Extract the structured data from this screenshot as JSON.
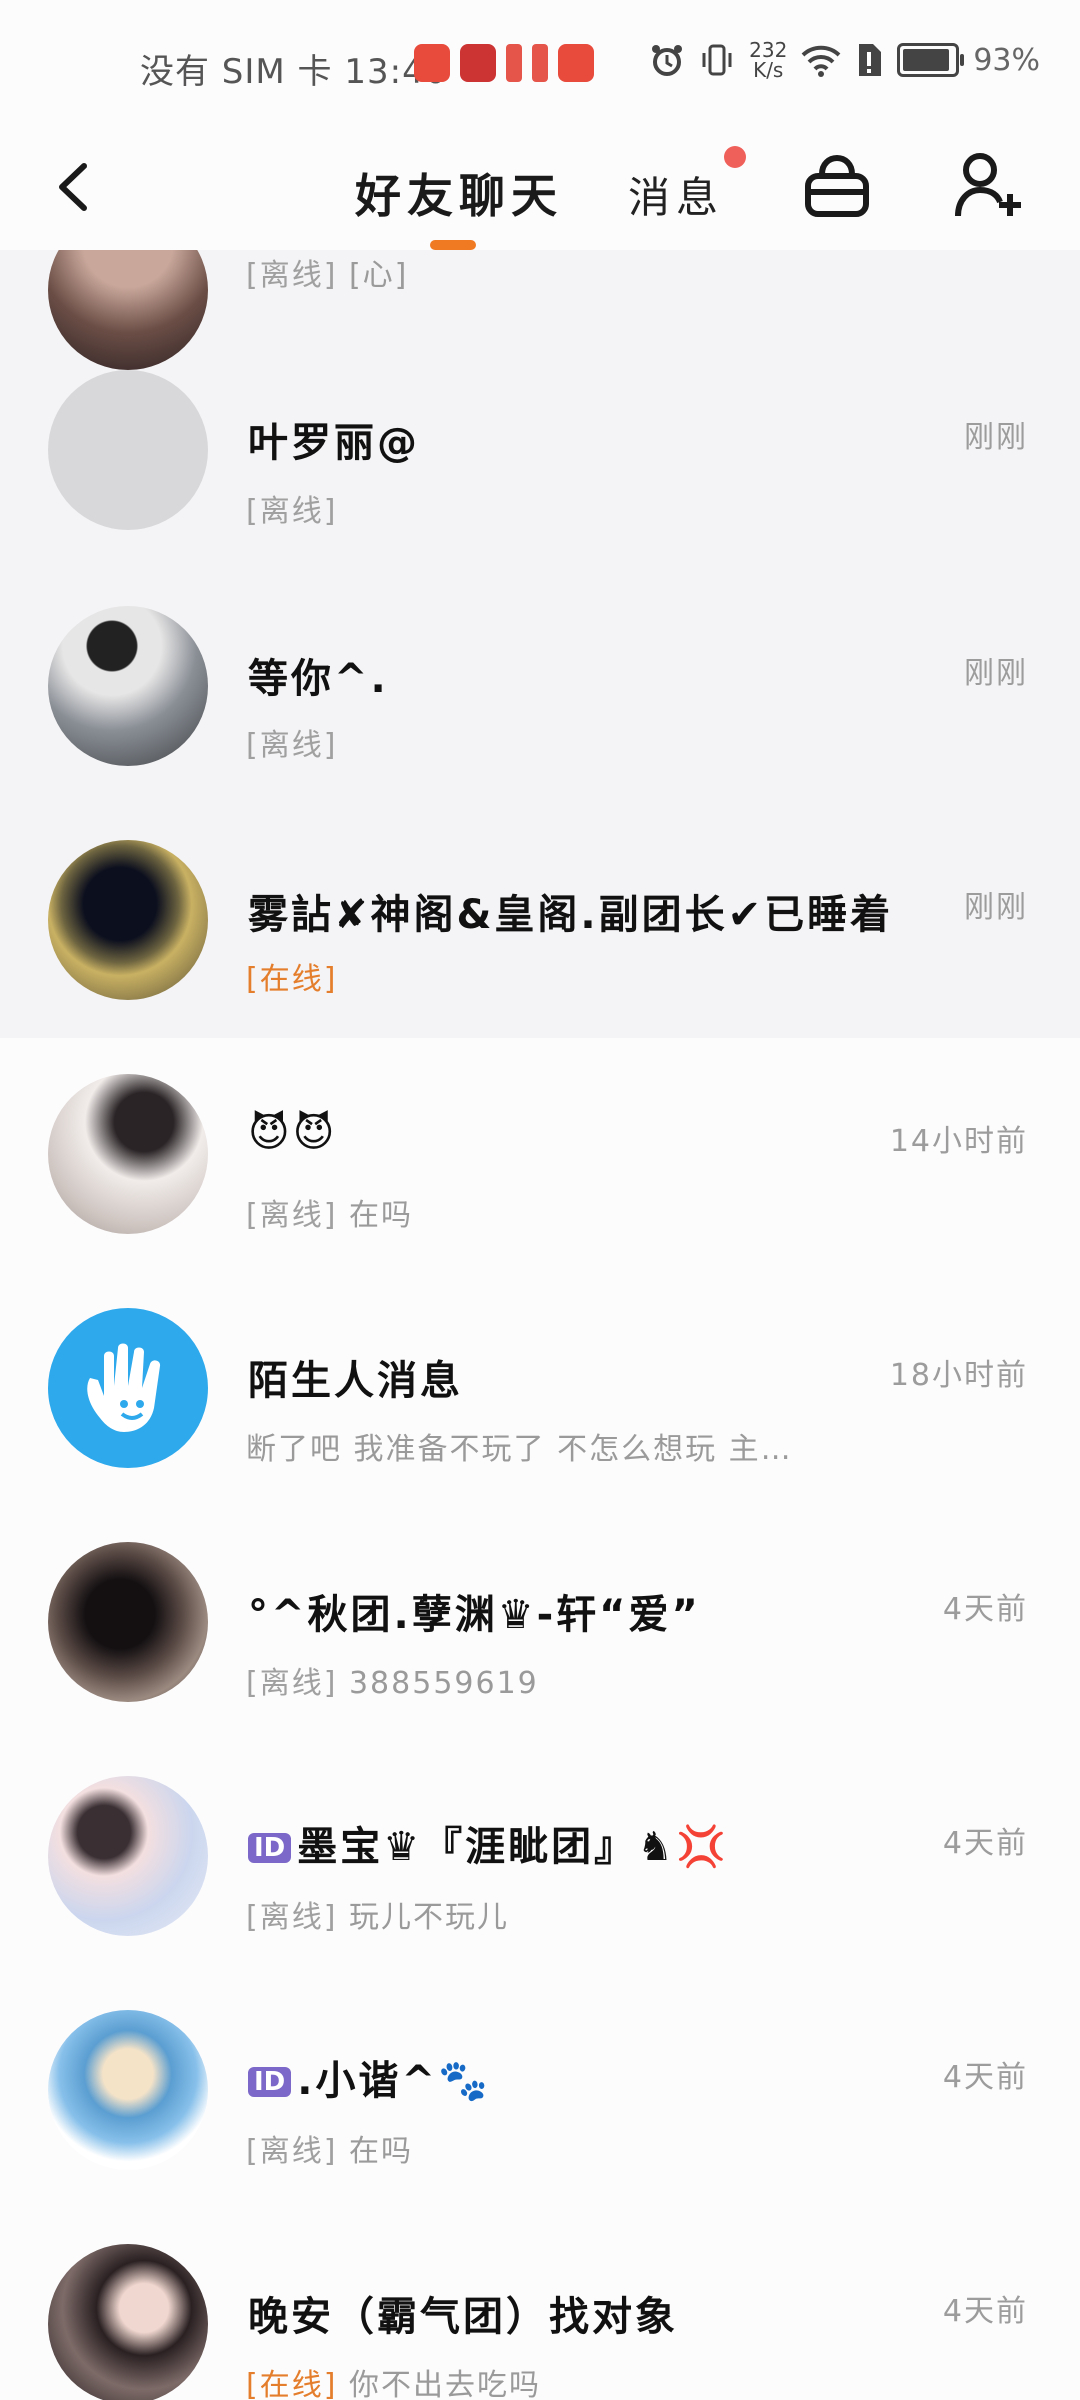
{
  "statusbar": {
    "carrier": "没有 SIM 卡",
    "time": "13:40",
    "speed_value": "232",
    "speed_unit": "K/s",
    "battery": "93%",
    "battery_level": 0.93
  },
  "nav": {
    "tab_friends": "好友聊天",
    "tab_messages": "消息",
    "accent_color": "#f07a22"
  },
  "chats": [
    {
      "name": "",
      "tag": "[离线]",
      "preview": "[心]",
      "time": "",
      "online": false,
      "avatar": "photo-partial"
    },
    {
      "name": "叶罗丽@",
      "tag": "[离线]",
      "preview": "",
      "time": "刚刚",
      "online": false,
      "avatar": "placeholder"
    },
    {
      "name": "等你^.",
      "tag": "[离线]",
      "preview": "",
      "time": "刚刚",
      "online": false,
      "avatar": "photo-girl-backpack"
    },
    {
      "name": "雾詀✘神阁&皇阁.副团长✔已睡着",
      "tag": "[在线]",
      "preview": "",
      "time": "刚刚",
      "online": true,
      "avatar": "photo-hoodie"
    },
    {
      "name": "😈😈",
      "tag": "[离线]",
      "preview": "在吗",
      "time": "14小时前",
      "online": false,
      "avatar": "photo-boy"
    },
    {
      "name": "陌生人消息",
      "tag": "",
      "preview": "断了吧 我准备不玩了 不怎么想玩 主…",
      "time": "18小时前",
      "online": false,
      "avatar": "stranger-hand-icon"
    },
    {
      "name": "°^秋团.孽渊♛-轩“爱”",
      "tag": "[离线]",
      "preview": "388559619",
      "time": "4天前",
      "online": false,
      "avatar": "photo-dark"
    },
    {
      "name": "墨宝♛『涯眦团』♞💢",
      "badge": "ID",
      "tag": "[离线]",
      "preview": "玩儿不玩儿",
      "time": "4天前",
      "online": false,
      "avatar": "anime-girl"
    },
    {
      "name": ".小谐^🐾",
      "badge": "ID",
      "tag": "[离线]",
      "preview": "在吗",
      "time": "4天前",
      "online": false,
      "avatar": "anime-blue"
    },
    {
      "name": "晚安（霸气团）找对象",
      "tag": "[在线]",
      "preview": "你不出去吃吗",
      "time": "4天前",
      "online": true,
      "avatar": "photo-peace"
    }
  ]
}
